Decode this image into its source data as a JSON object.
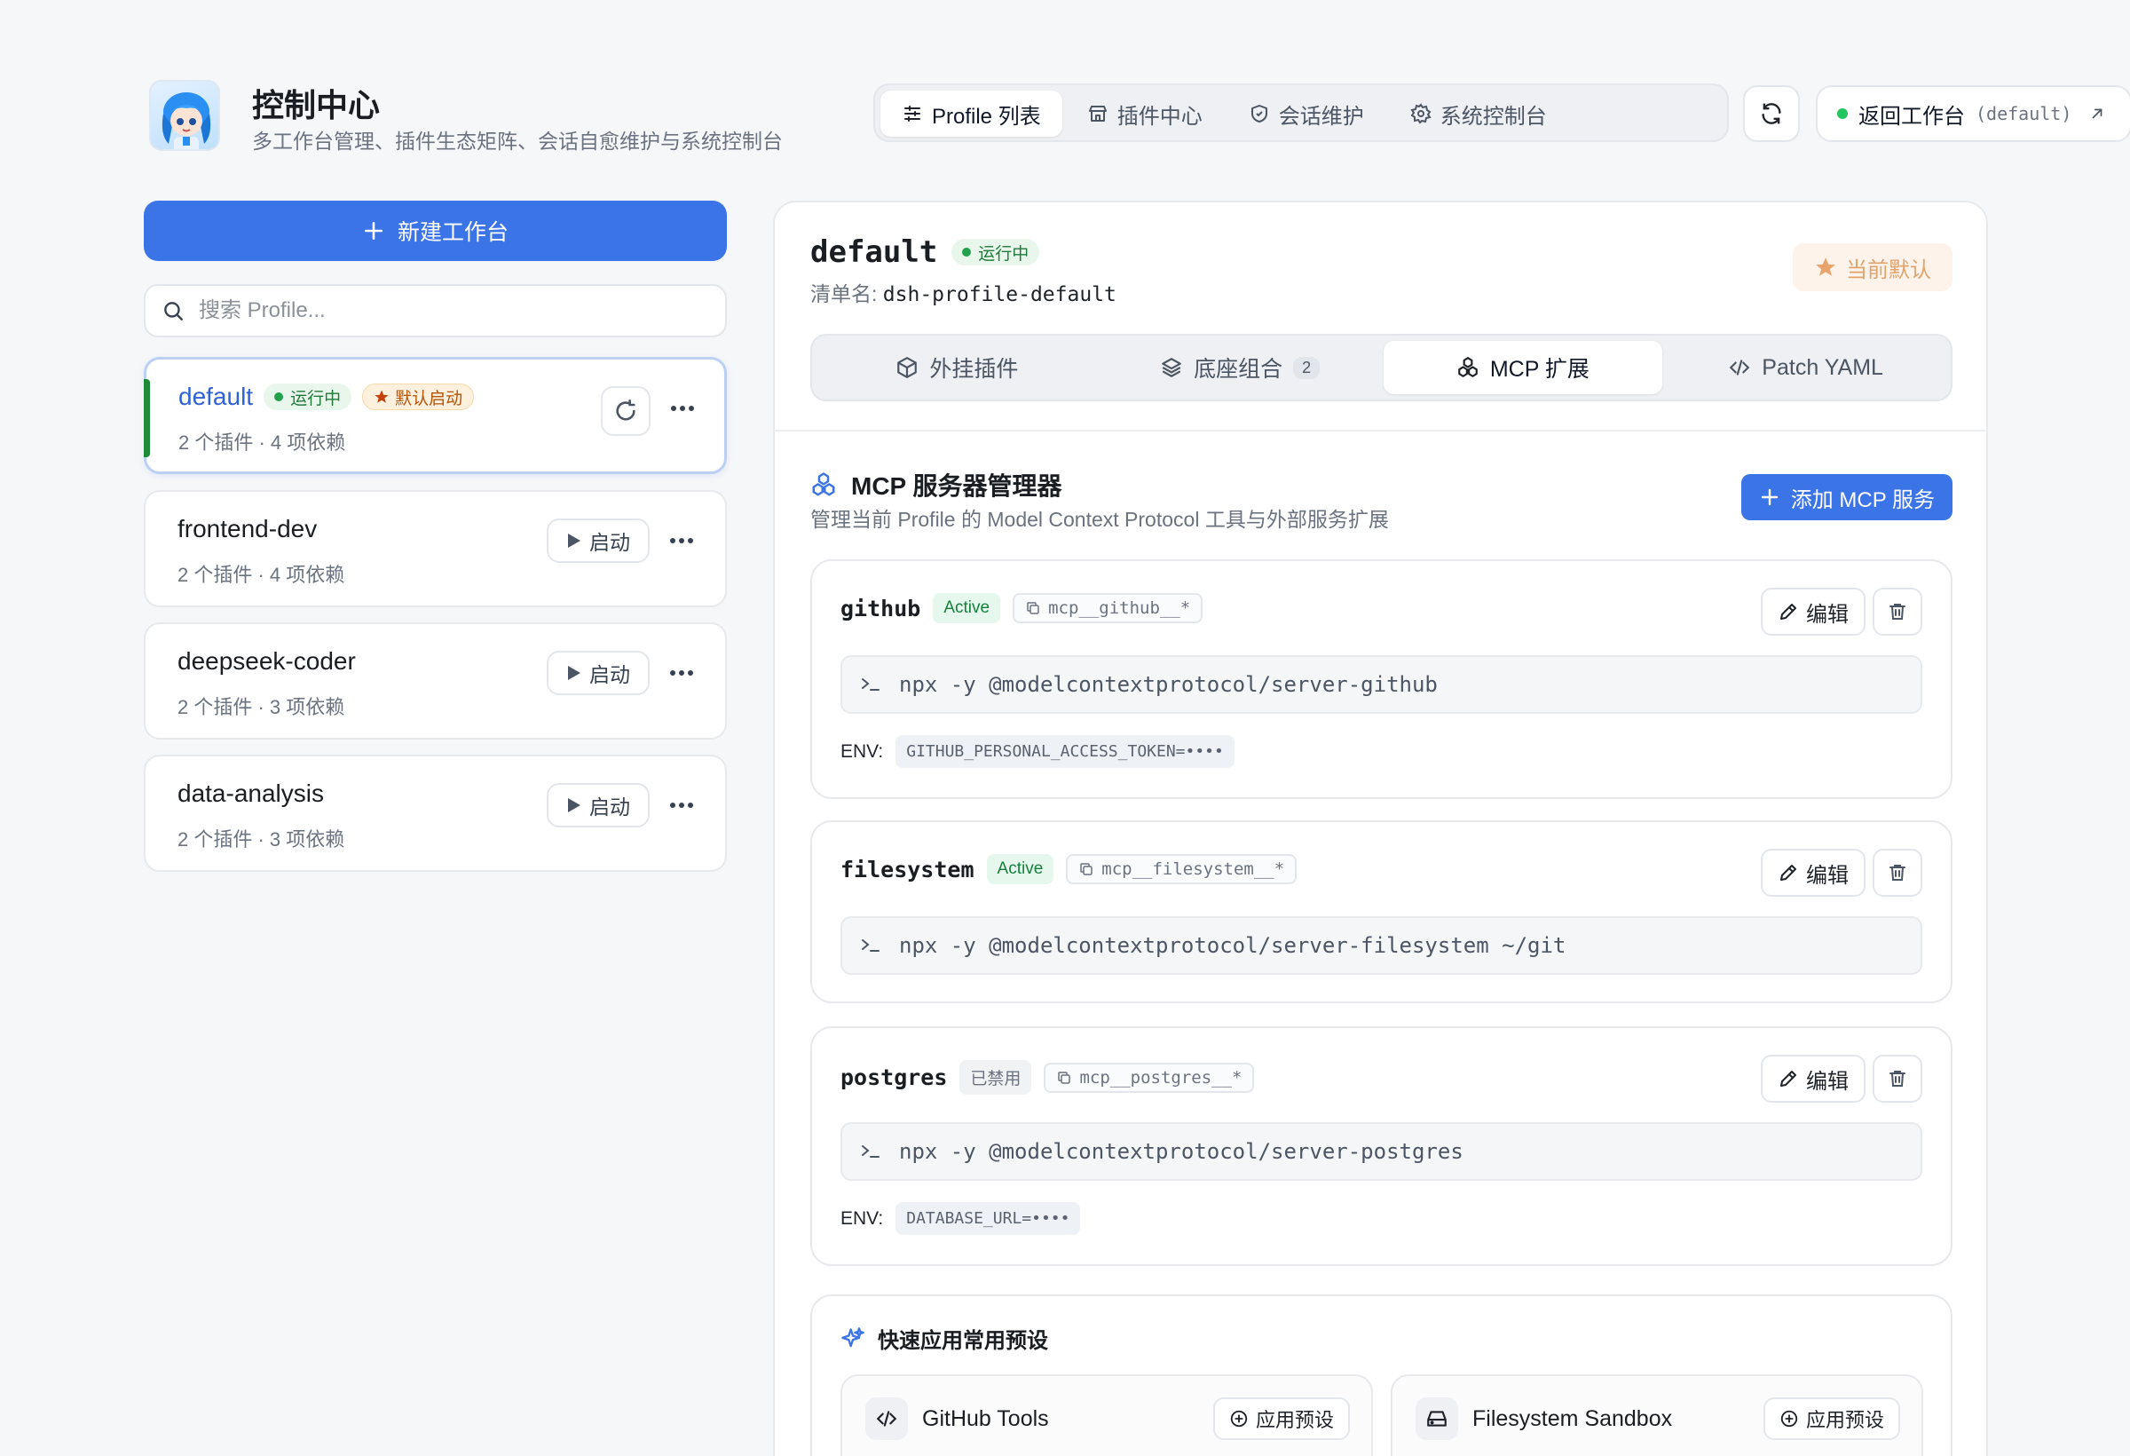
{
  "header": {
    "title": "控制中心",
    "subtitle": "多工作台管理、插件生态矩阵、会话自愈维护与系统控制台",
    "nav": [
      {
        "label": "Profile 列表",
        "icon": "list-sliders-icon"
      },
      {
        "label": "插件中心",
        "icon": "store-icon"
      },
      {
        "label": "会话维护",
        "icon": "shield-icon"
      },
      {
        "label": "系统控制台",
        "icon": "gear-icon"
      }
    ],
    "back_label": "返回工作台",
    "back_profile": "(default)"
  },
  "sidebar": {
    "new_label": "新建工作台",
    "search_placeholder": "搜索 Profile...",
    "profiles": [
      {
        "name": "default",
        "status": "运行中",
        "default_badge": "默认启动",
        "meta": "2 个插件 · 4 项依赖"
      },
      {
        "name": "frontend-dev",
        "action": "启动",
        "meta": "2 个插件 · 4 项依赖"
      },
      {
        "name": "deepseek-coder",
        "action": "启动",
        "meta": "2 个插件 · 3 项依赖"
      },
      {
        "name": "data-analysis",
        "action": "启动",
        "meta": "2 个插件 · 3 项依赖"
      }
    ]
  },
  "main": {
    "profile_name": "default",
    "status": "运行中",
    "manifest_label": "清单名:",
    "manifest_value": "dsh-profile-default",
    "current_default": "当前默认",
    "tabs": [
      {
        "label": "外挂插件"
      },
      {
        "label": "底座组合",
        "count": "2"
      },
      {
        "label": "MCP 扩展"
      },
      {
        "label": "Patch YAML"
      }
    ],
    "section_title": "MCP 服务器管理器",
    "section_sub": "管理当前 Profile 的 Model Context Protocol 工具与外部服务扩展",
    "add_label": "添加 MCP 服务",
    "edit_label": "编辑",
    "env_label": "ENV:",
    "servers": [
      {
        "name": "github",
        "status": "Active",
        "ns": "mcp__github__*",
        "cmd": "npx -y @modelcontextprotocol/server-github",
        "env": "GITHUB_PERSONAL_ACCESS_TOKEN=••••"
      },
      {
        "name": "filesystem",
        "status": "Active",
        "ns": "mcp__filesystem__*",
        "cmd": "npx -y @modelcontextprotocol/server-filesystem ~/git"
      },
      {
        "name": "postgres",
        "status": "已禁用",
        "ns": "mcp__postgres__*",
        "cmd": "npx -y @modelcontextprotocol/server-postgres",
        "env": "DATABASE_URL=••••"
      }
    ],
    "presets_title": "快速应用常用预设",
    "apply_label": "应用预设",
    "presets": [
      {
        "name": "GitHub Tools"
      },
      {
        "name": "Filesystem Sandbox"
      }
    ]
  },
  "colors": {
    "accent": "#3b74e6",
    "running": "#22a04b",
    "default_badge": "#b45309"
  }
}
